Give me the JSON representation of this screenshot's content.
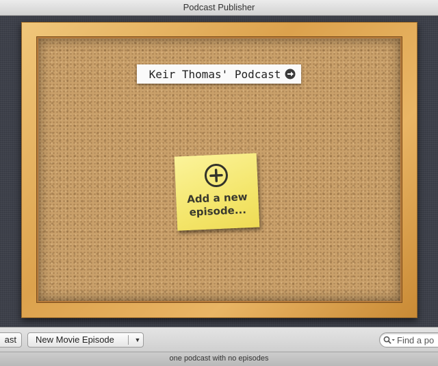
{
  "window": {
    "title": "Podcast Publisher"
  },
  "board": {
    "podcast_title": "Keir Thomas' Podcast",
    "podcast_arrow_icon": "circle-arrow-right-icon",
    "sticky_note": {
      "icon": "circle-plus-icon",
      "text": "Add a new\nepisode..."
    }
  },
  "toolbar": {
    "left_button_label": "ast",
    "movie_button_label": "New Movie Episode",
    "movie_menu_icon": "triangle-down-icon",
    "search": {
      "placeholder": "Find a po",
      "value": "",
      "icon": "magnifier-icon"
    }
  },
  "status": {
    "text": "one podcast with no episodes"
  },
  "colors": {
    "frame_wood": "#dca24d",
    "cork": "#c9a06a",
    "sticky_note": "#f4e66c",
    "backdrop": "#3d404a"
  }
}
